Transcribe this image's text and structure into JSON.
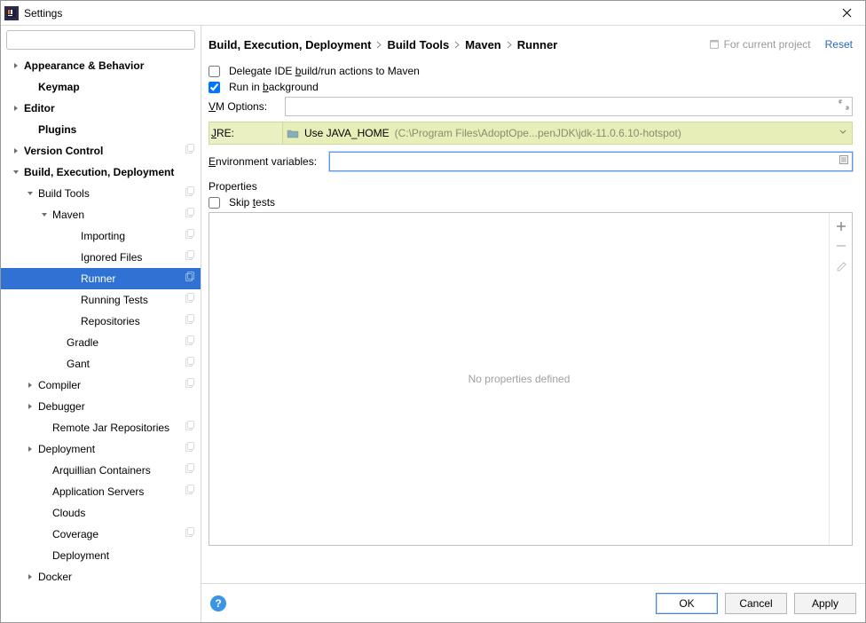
{
  "window": {
    "title": "Settings"
  },
  "search": {
    "placeholder": ""
  },
  "sidebar": {
    "items": [
      {
        "label": "Appearance & Behavior",
        "indent": 0,
        "caret": "right",
        "bold": true,
        "icon": false
      },
      {
        "label": "Keymap",
        "indent": 1,
        "caret": "none",
        "bold": true,
        "icon": false
      },
      {
        "label": "Editor",
        "indent": 0,
        "caret": "right",
        "bold": true,
        "icon": false
      },
      {
        "label": "Plugins",
        "indent": 1,
        "caret": "none",
        "bold": true,
        "icon": false
      },
      {
        "label": "Version Control",
        "indent": 0,
        "caret": "right",
        "bold": true,
        "icon": true
      },
      {
        "label": "Build, Execution, Deployment",
        "indent": 0,
        "caret": "down",
        "bold": true,
        "icon": false
      },
      {
        "label": "Build Tools",
        "indent": 1,
        "caret": "down",
        "bold": false,
        "icon": true
      },
      {
        "label": "Maven",
        "indent": 2,
        "caret": "down",
        "bold": false,
        "icon": true
      },
      {
        "label": "Importing",
        "indent": 4,
        "caret": "none",
        "bold": false,
        "icon": true
      },
      {
        "label": "Ignored Files",
        "indent": 4,
        "caret": "none",
        "bold": false,
        "icon": true
      },
      {
        "label": "Runner",
        "indent": 4,
        "caret": "none",
        "bold": false,
        "icon": true,
        "selected": true
      },
      {
        "label": "Running Tests",
        "indent": 4,
        "caret": "none",
        "bold": false,
        "icon": true
      },
      {
        "label": "Repositories",
        "indent": 4,
        "caret": "none",
        "bold": false,
        "icon": true
      },
      {
        "label": "Gradle",
        "indent": 3,
        "caret": "none",
        "bold": false,
        "icon": true
      },
      {
        "label": "Gant",
        "indent": 3,
        "caret": "none",
        "bold": false,
        "icon": true
      },
      {
        "label": "Compiler",
        "indent": 1,
        "caret": "right",
        "bold": false,
        "icon": true
      },
      {
        "label": "Debugger",
        "indent": 1,
        "caret": "right",
        "bold": false,
        "icon": false
      },
      {
        "label": "Remote Jar Repositories",
        "indent": 2,
        "caret": "none",
        "bold": false,
        "icon": true
      },
      {
        "label": "Deployment",
        "indent": 1,
        "caret": "right",
        "bold": false,
        "icon": true
      },
      {
        "label": "Arquillian Containers",
        "indent": 2,
        "caret": "none",
        "bold": false,
        "icon": true
      },
      {
        "label": "Application Servers",
        "indent": 2,
        "caret": "none",
        "bold": false,
        "icon": true
      },
      {
        "label": "Clouds",
        "indent": 2,
        "caret": "none",
        "bold": false,
        "icon": false
      },
      {
        "label": "Coverage",
        "indent": 2,
        "caret": "none",
        "bold": false,
        "icon": true
      },
      {
        "label": "Deployment",
        "indent": 2,
        "caret": "none",
        "bold": false,
        "icon": false
      },
      {
        "label": "Docker",
        "indent": 1,
        "caret": "right",
        "bold": false,
        "icon": false
      }
    ]
  },
  "breadcrumb": {
    "parts": [
      "Build, Execution, Deployment",
      "Build Tools",
      "Maven",
      "Runner"
    ]
  },
  "project_note": "For current project",
  "reset_label": "Reset",
  "form": {
    "delegate_label_pre": "Delegate IDE ",
    "delegate_u": "b",
    "delegate_label_post": "uild/run actions to Maven",
    "delegate_checked": false,
    "background_pre": "Run in ",
    "background_u": "b",
    "background_post": "ackground",
    "background_checked": true,
    "vm_label_u": "V",
    "vm_label_rest": "M Options:",
    "vm_value": "",
    "jre_label_u": "J",
    "jre_label_rest": "RE:",
    "jre_value": "Use JAVA_HOME",
    "jre_path": " (C:\\Program Files\\AdoptOpe...penJDK\\jdk-11.0.6.10-hotspot)",
    "env_label_pre": "",
    "env_label_u": "E",
    "env_label_post": "nvironment variables:",
    "env_value": "",
    "properties_section": "Properties",
    "skip_tests_pre": "Skip ",
    "skip_tests_u": "t",
    "skip_tests_post": "ests",
    "skip_tests_checked": false,
    "no_props": "No properties defined"
  },
  "buttons": {
    "ok": "OK",
    "cancel": "Cancel",
    "apply": "Apply"
  }
}
